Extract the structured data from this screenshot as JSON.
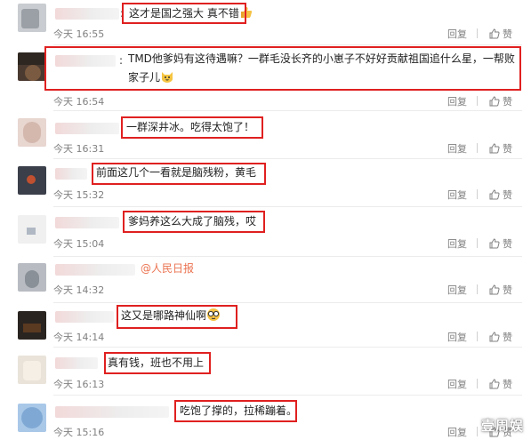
{
  "comments": [
    {
      "text": "这才是国之强大 真不错",
      "emoji": "thumbs-up-emoji",
      "time": "今天 16:55",
      "reply": "回复",
      "like": "赞"
    },
    {
      "text": "TMD他爹妈有这待遇嘛？一群毛没长齐的小崽子不好好贡献祖国追什么星，一帮败家子儿",
      "emoji": "cat-face-emoji",
      "time": "今天 16:54",
      "reply": "回复",
      "like": "赞"
    },
    {
      "text": "一群深井冰。吃得太饱了！",
      "time": "今天 16:31",
      "reply": "回复",
      "like": "赞"
    },
    {
      "text": "前面这几个一看就是脑残粉，黄毛",
      "time": "今天 15:32",
      "reply": "回复",
      "like": "赞"
    },
    {
      "text": "爹妈养这么大成了脑残，哎",
      "time": "今天 15:04",
      "reply": "回复",
      "like": "赞"
    },
    {
      "text": "@人民日报",
      "time": "今天 14:32",
      "reply": "回复",
      "like": "赞"
    },
    {
      "text": "这又是哪路神仙啊",
      "emoji": "glasses-face-emoji",
      "time": "今天 14:14",
      "reply": "回复",
      "like": "赞"
    },
    {
      "text": "真有钱，班也不用上",
      "time": "今天 16:13",
      "reply": "回复",
      "like": "赞"
    },
    {
      "text": "吃饱了撑的，拉稀蹦着。",
      "time": "今天 15:16",
      "reply": "回复",
      "like": "赞"
    }
  ],
  "watermark": "壹周娱",
  "colors": {
    "highlight": "#e02020",
    "mention": "#eb7350",
    "meta": "#808080"
  }
}
